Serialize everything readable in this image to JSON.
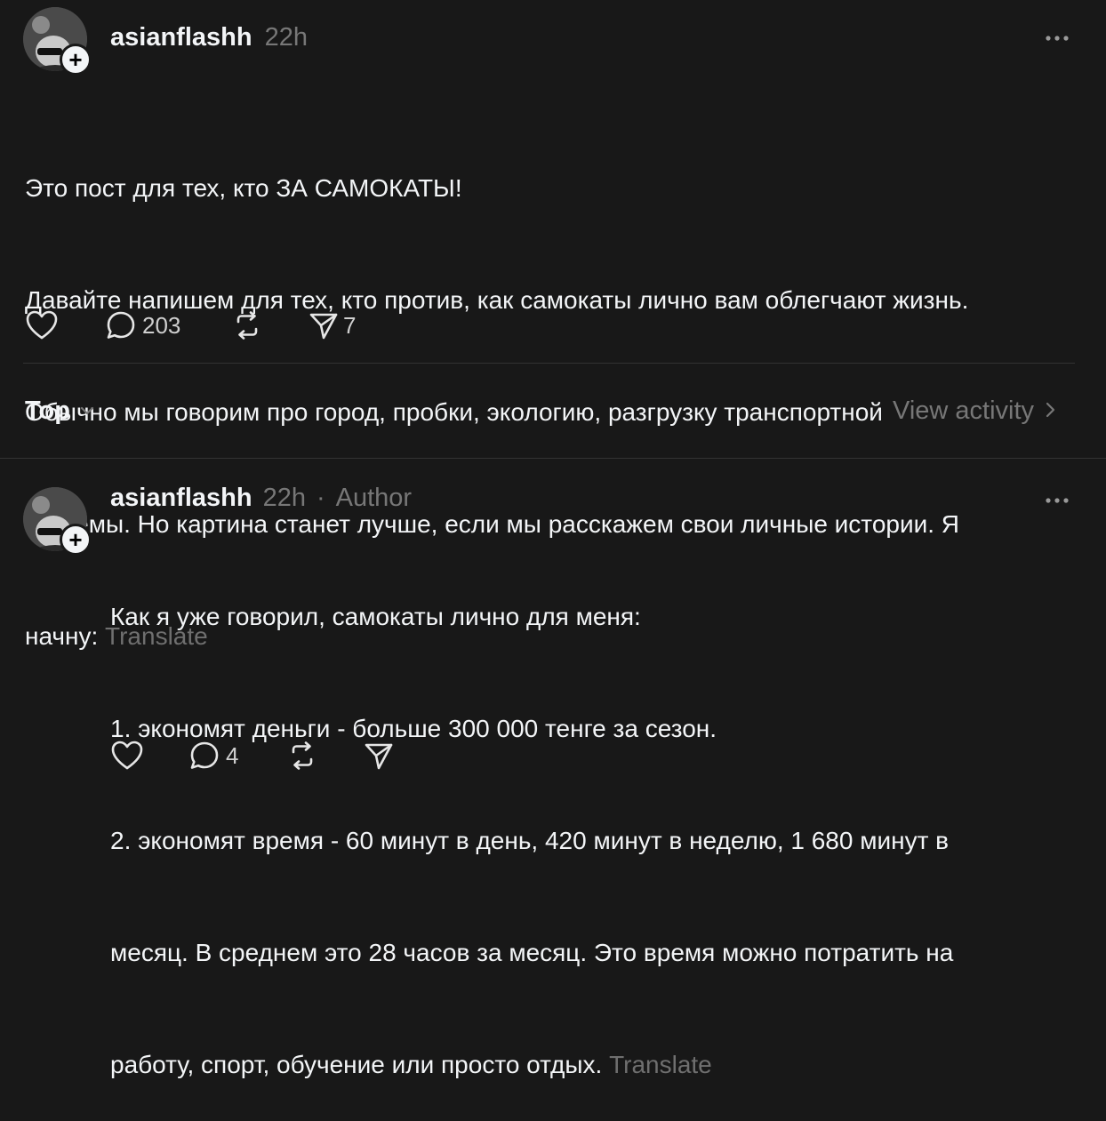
{
  "post": {
    "username": "asianflashh",
    "time": "22h",
    "text_lines": [
      "Это пост для тех, кто ЗА САМОКАТЫ!",
      "Давайте напишем для тех, кто против, как самокаты лично вам облегчают жизнь.",
      "Обычно мы говорим про город, пробки, экологию, разгрузку транспортной",
      "системы. Но картина станет лучше, если мы расскажем свои личные истории. Я",
      "начну: "
    ],
    "translate": "Translate",
    "replies_count": "203",
    "shares_count": "7",
    "icons": {
      "like": "heart-icon",
      "reply": "comment-icon",
      "repost": "repost-icon",
      "share": "send-icon",
      "more": "more-icon"
    }
  },
  "sort": {
    "label": "Top",
    "view_activity": "View activity"
  },
  "reply": {
    "username": "asianflashh",
    "time": "22h",
    "separator": "·",
    "author_badge": "Author",
    "text_lines": [
      "Как я уже говорил, самокаты лично для меня:",
      "1. экономят деньги - больше 300 000 тенге за сезон.",
      "2. экономят время - 60 минут в день, 420 минут в неделю, 1 680 минут в",
      "месяц. В среднем это 28 часов за месяц. Это время можно потратить на",
      "работу, спорт, обучение или просто отдых. "
    ],
    "translate": "Translate",
    "replies_count": "4"
  },
  "colors": {
    "background": "#181818",
    "text": "#f3f5f7",
    "muted": "#777777",
    "divider": "#333333"
  }
}
